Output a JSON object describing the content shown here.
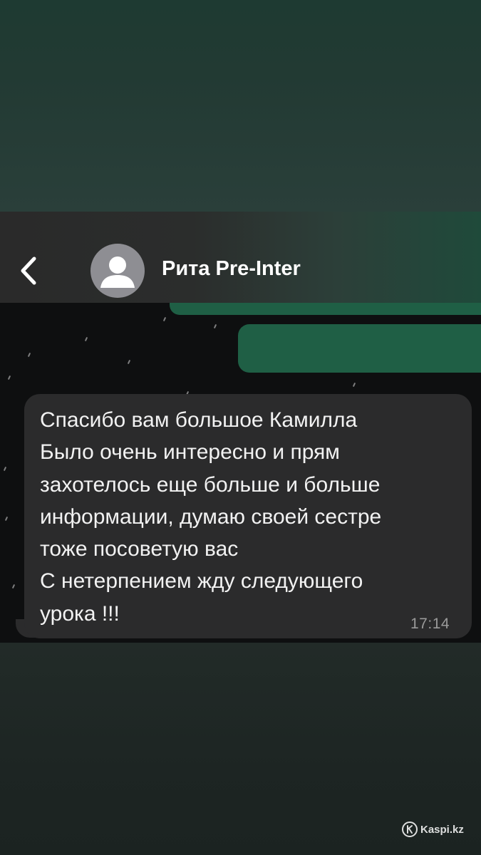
{
  "header": {
    "back_icon": "chevron-left-icon",
    "avatar_icon": "person-avatar-icon",
    "contact_name": "Рита Pre-Inter"
  },
  "message": {
    "lines": [
      "Спасибо вам большое Камилла",
      "Было очень интересно и прям",
      "захотелось еще больше и больше",
      "информации, думаю своей сестре",
      "тоже посоветую вас",
      "С нетерпением жду следующего",
      "урока !!!"
    ],
    "time": "17:14"
  },
  "watermark": {
    "text": "Kaspi.kz"
  },
  "colors": {
    "sent_bubble": "#1f5f45",
    "received_bubble": "#2b2b2c",
    "chat_background": "#0e0f10"
  }
}
